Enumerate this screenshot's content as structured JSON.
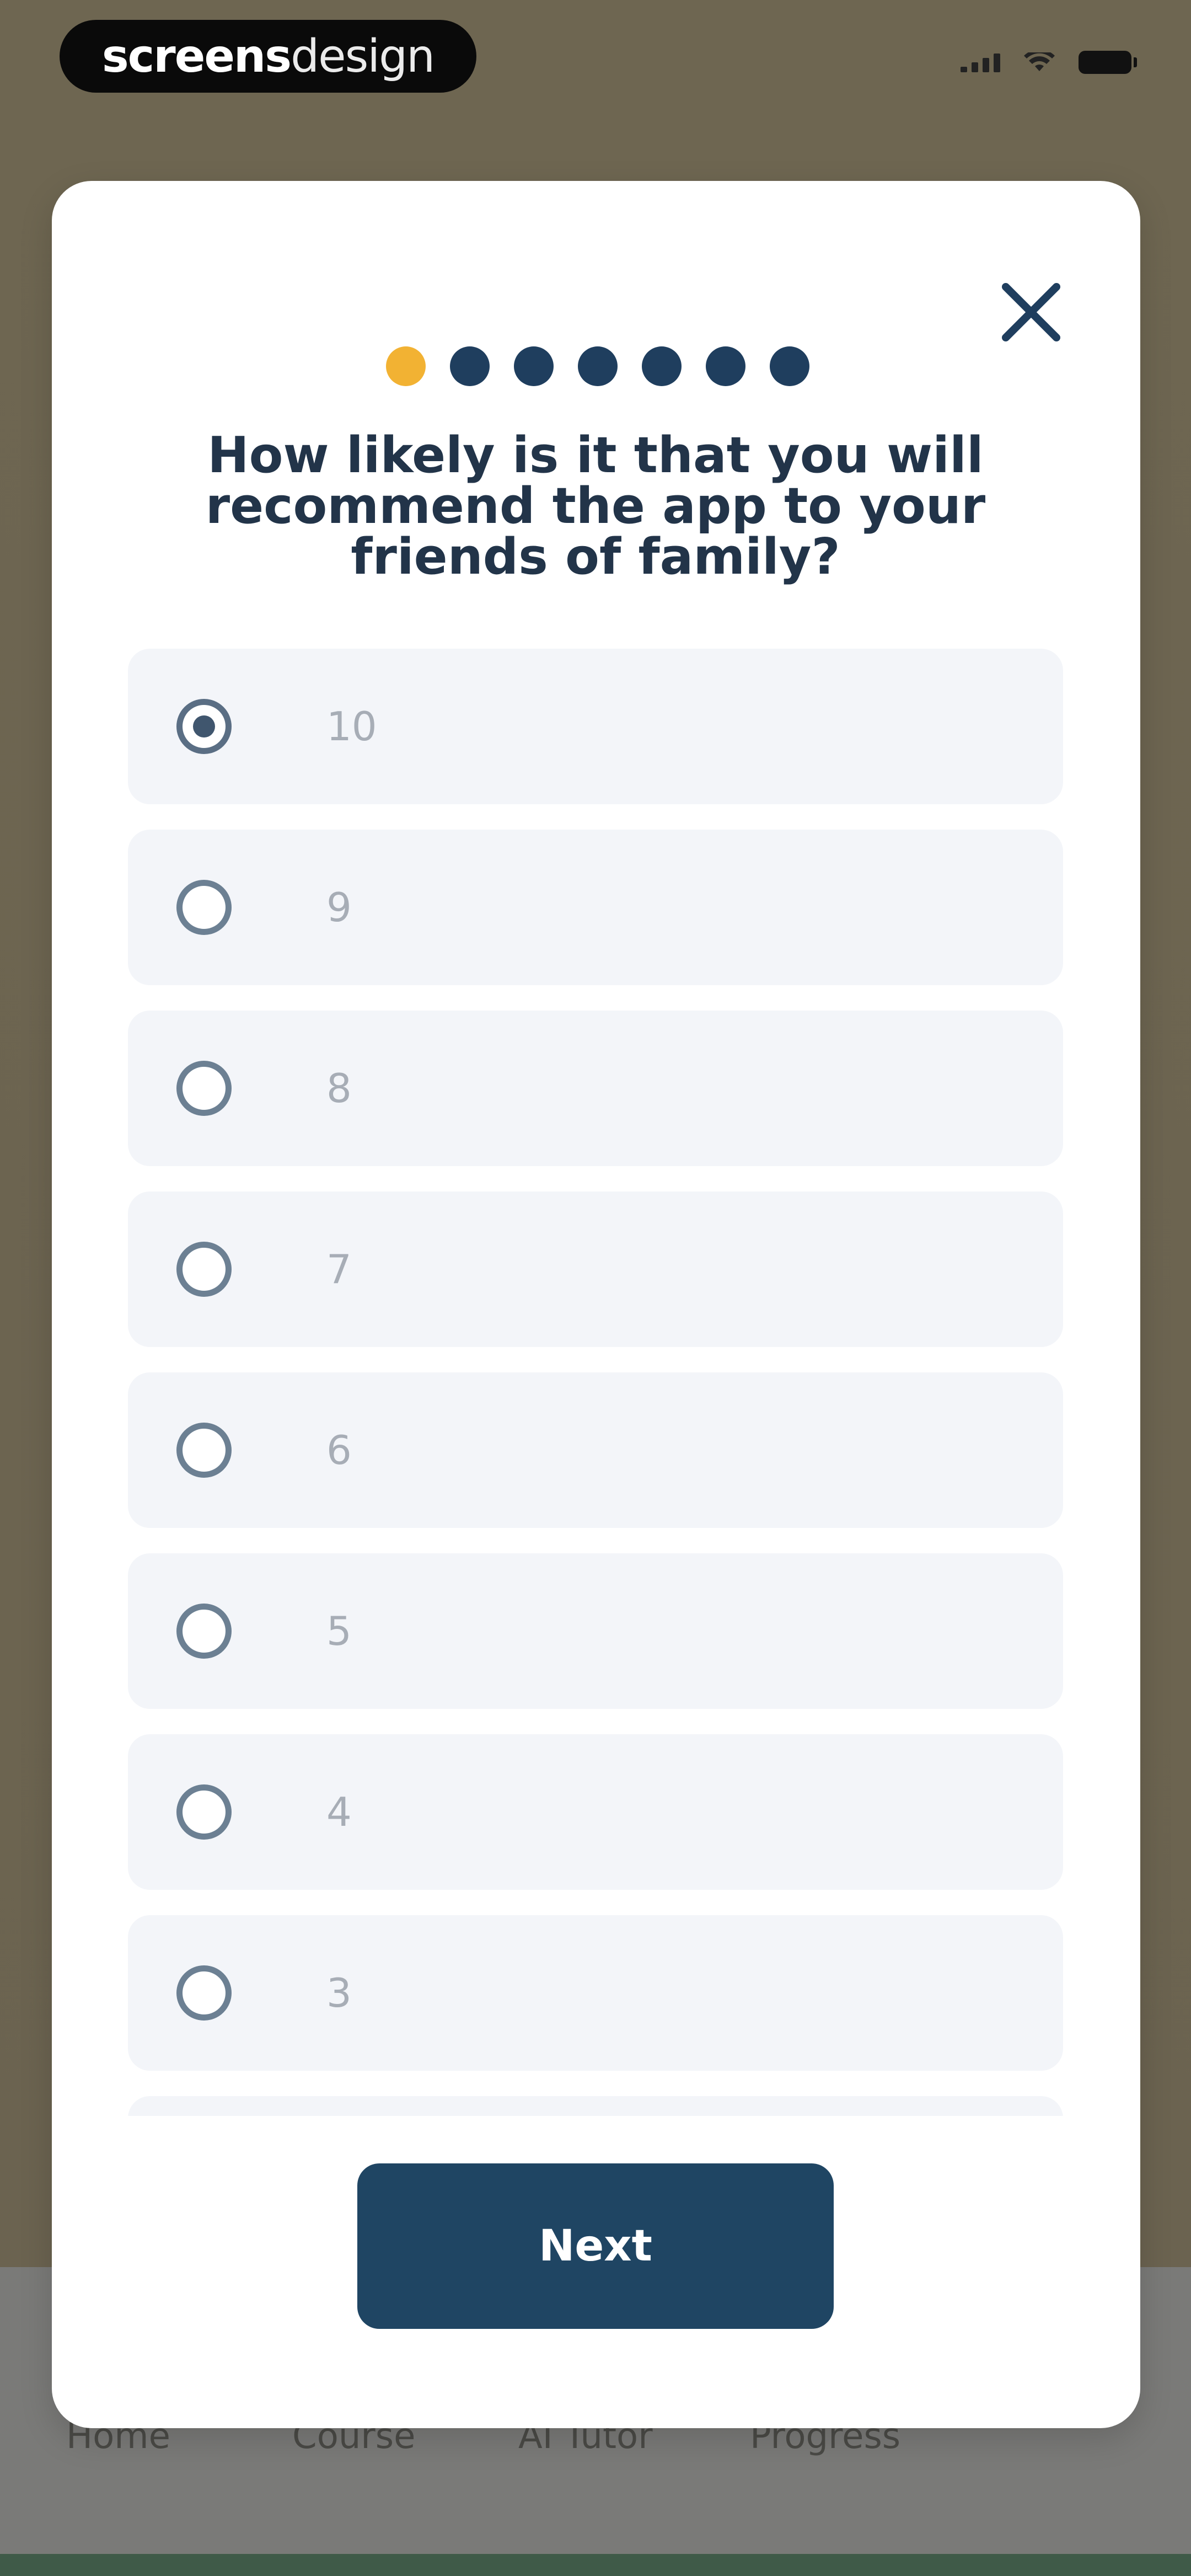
{
  "status_bar": {
    "brand_bold": "screens",
    "brand_light": "design",
    "icons": [
      "signal-icon",
      "wifi-icon",
      "battery-icon"
    ]
  },
  "bottom_nav": {
    "items": [
      {
        "label": "Home"
      },
      {
        "label": "Course"
      },
      {
        "label": "AI Tutor"
      },
      {
        "label": "Progress"
      }
    ]
  },
  "survey": {
    "steps_total": 7,
    "current_step": 1,
    "question": "How likely is it that you will recommend the app to your friends of family?",
    "options": [
      {
        "label": "10",
        "selected": true
      },
      {
        "label": "9",
        "selected": false
      },
      {
        "label": "8",
        "selected": false
      },
      {
        "label": "7",
        "selected": false
      },
      {
        "label": "6",
        "selected": false
      },
      {
        "label": "5",
        "selected": false
      },
      {
        "label": "4",
        "selected": false
      },
      {
        "label": "3",
        "selected": false
      },
      {
        "label": "",
        "selected": false
      }
    ],
    "next_label": "Next"
  },
  "colors": {
    "accent_active_dot": "#f2b233",
    "primary_navy": "#1f4563",
    "option_bg": "#f3f5f9"
  }
}
